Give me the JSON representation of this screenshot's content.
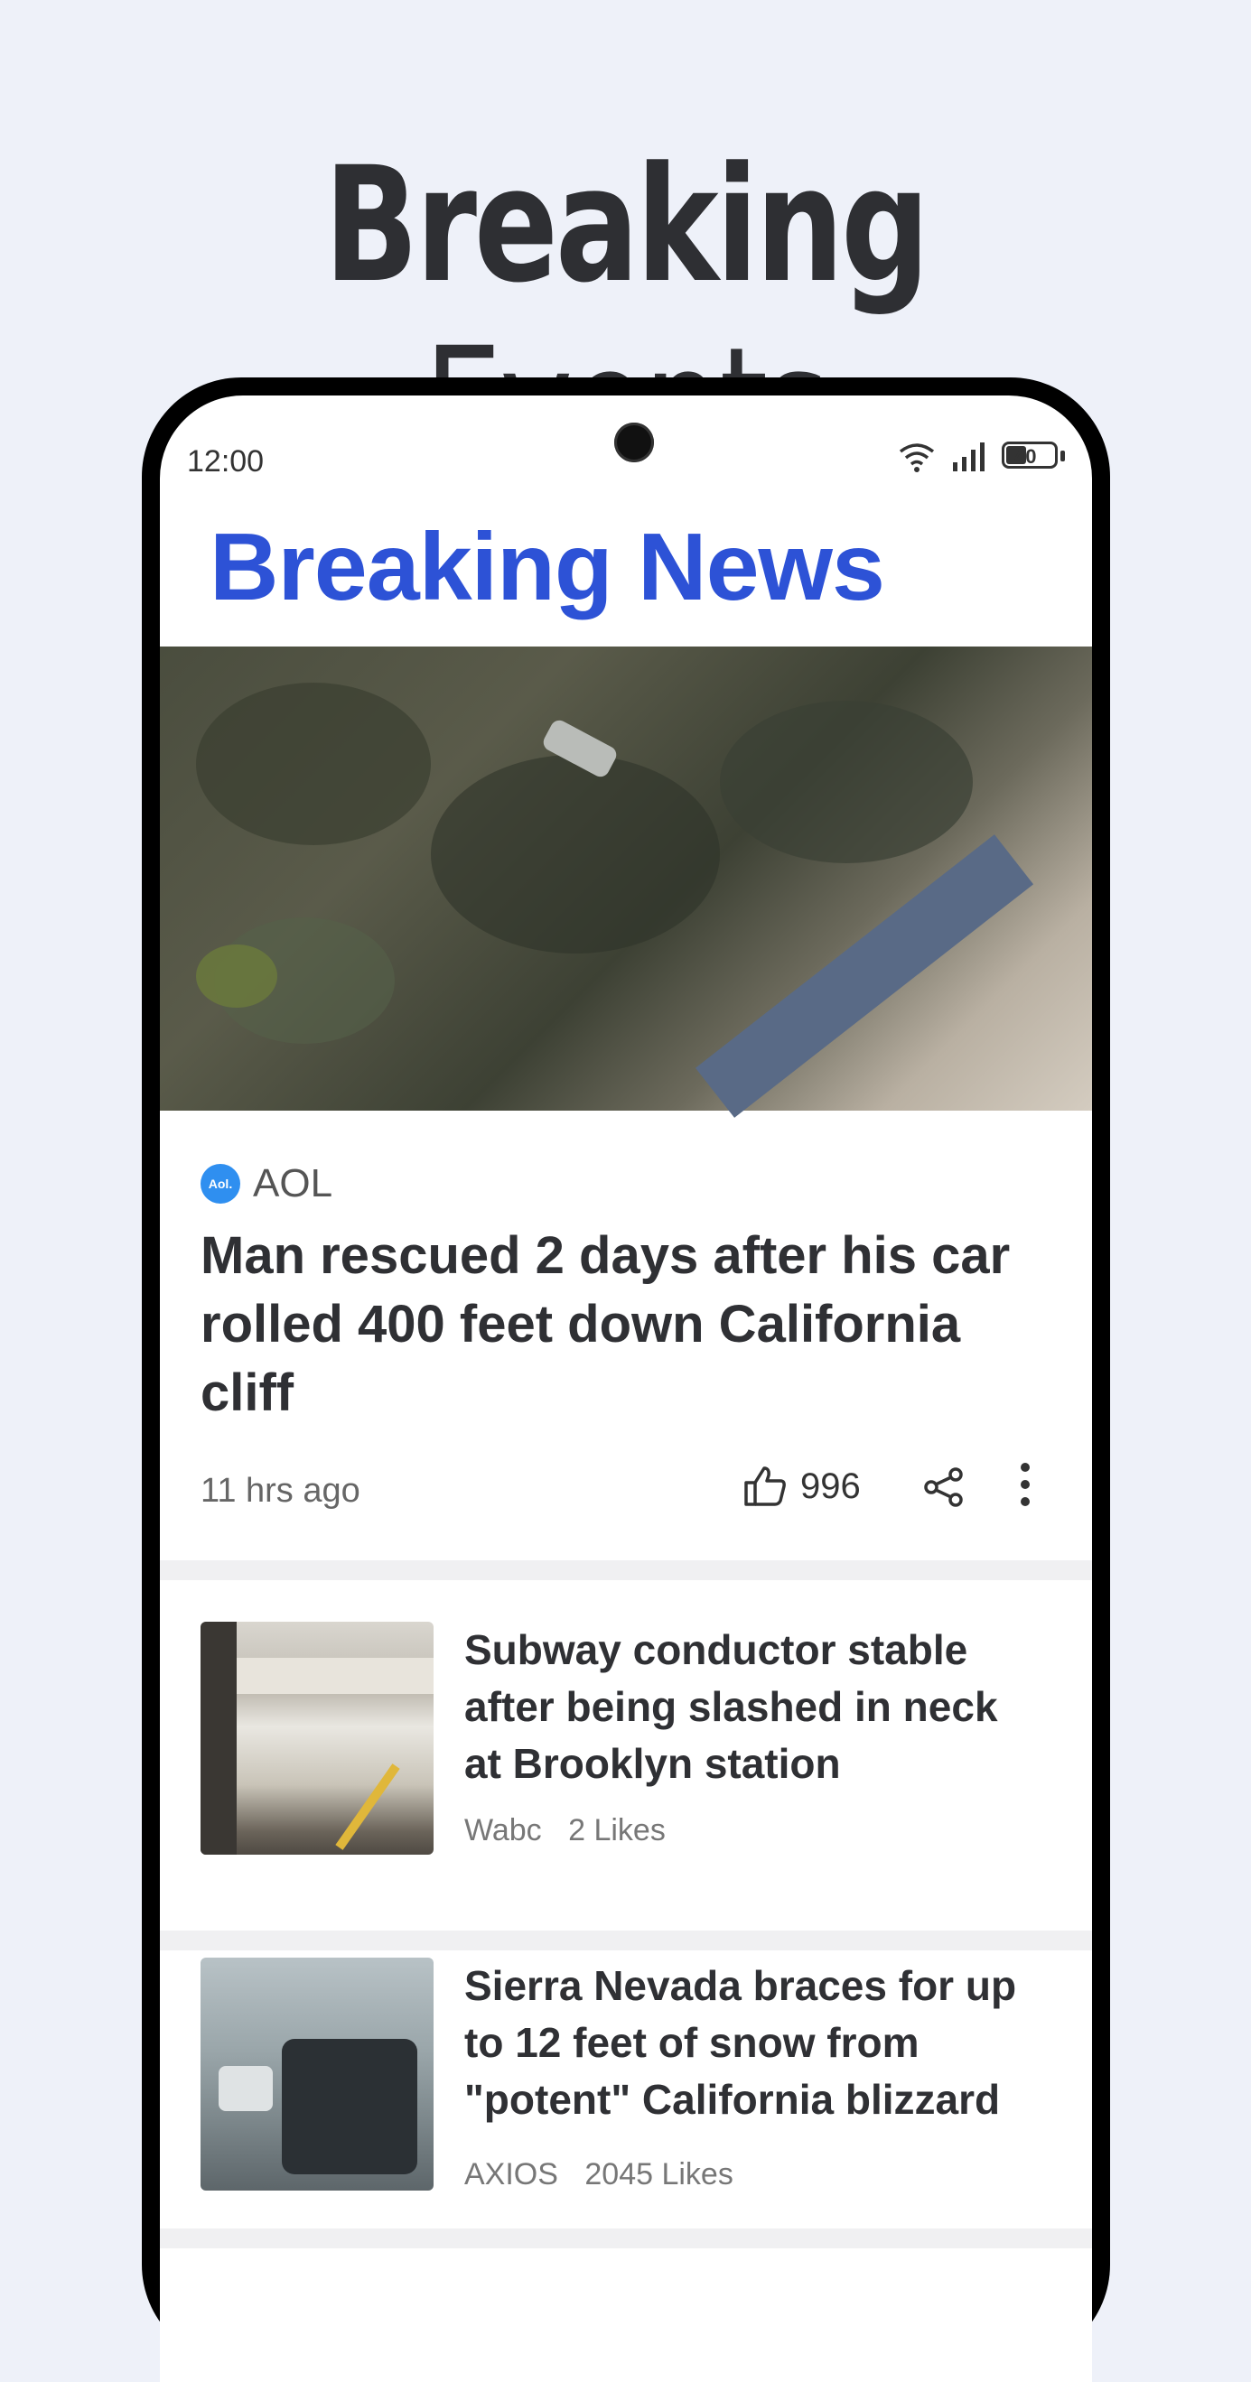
{
  "banner": {
    "title_bold": "Breaking",
    "title_light": "Events"
  },
  "status_bar": {
    "time": "12:00",
    "battery": "40"
  },
  "app": {
    "title": "Breaking News"
  },
  "featured": {
    "source": "AOL",
    "source_badge": "Aol.",
    "title": "Man rescued 2 days after his car rolled 400 feet down California cliff",
    "time_ago": "11 hrs ago",
    "likes": "996"
  },
  "articles": [
    {
      "title": "Subway conductor stable after being slashed in neck at Brooklyn station",
      "source": "Wabc",
      "likes": "2 Likes"
    },
    {
      "title": "Sierra Nevada braces for up to 12 feet of snow from \"potent\" California blizzard",
      "source": "AXIOS",
      "likes": "2045 Likes"
    }
  ],
  "colors": {
    "accent": "#2d52d6",
    "background": "#eef1f9",
    "aol_blue": "#2f8ff0"
  },
  "icons": [
    "wifi-icon",
    "signal-icon",
    "battery-icon",
    "thumbs-up-icon",
    "share-icon",
    "more-vertical-icon"
  ]
}
